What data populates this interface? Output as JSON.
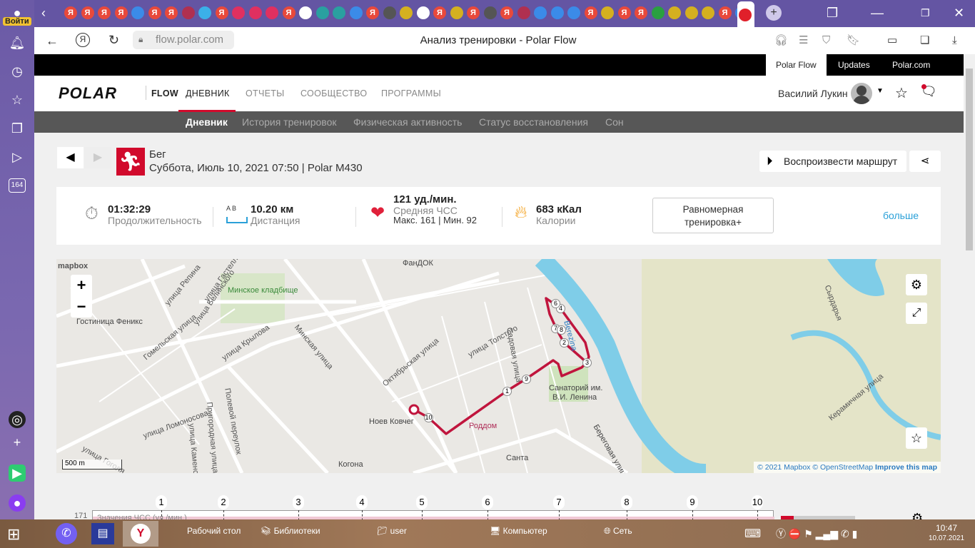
{
  "browser": {
    "login_label": "Войти",
    "sidebar_badge": "164",
    "url": "flow.polar.com",
    "title": "Анализ тренировки - Polar Flow",
    "tab_glyph": "Я"
  },
  "site_tabs": [
    "Polar Flow",
    "Updates",
    "Polar.com"
  ],
  "header": {
    "logo": "POLAR",
    "flow": "FLOW",
    "nav": [
      "ДНЕВНИК",
      "ОТЧЕТЫ",
      "СООБЩЕСТВО",
      "ПРОГРАММЫ"
    ],
    "user": "Василий Лукин"
  },
  "subnav": [
    "Дневник",
    "История тренировок",
    "Физическая активность",
    "Статус восстановления",
    "Сон"
  ],
  "workout": {
    "sport": "Бег",
    "datetime": "Суббота, Июль 10, 2021 07:50 | Polar M430",
    "replay": "Воспроизвести маршрут"
  },
  "stats": {
    "duration": "01:32:29",
    "duration_label": "Продолжительность",
    "distance": "10.20 км",
    "distance_label": "Дистанция",
    "ab": "A  B",
    "hr": "121 уд./мин.",
    "hr_label": "Средняя ЧСС",
    "hr_minmax": "Макс. 161  |  Мин. 92",
    "calories": "683 кКал",
    "calories_label": "Калории",
    "benefit": "Равномерная тренировка+",
    "more": "больше"
  },
  "map": {
    "brand": "mapbox",
    "scale": "500 m",
    "attribution": "© 2021 Mapbox © OpenStreetMap",
    "improve": "Improve this map",
    "labels": [
      "Минское кладбище",
      "Гостиница Феникс",
      "улица Репина",
      "улица Гастелло",
      "улица Белинского",
      "Гомельская улица",
      "улица Крылова",
      "Минская улица",
      "Октябрьская улица",
      "улица Толстого",
      "Садовая улица",
      "Санаторий им.",
      "В.И. Ленина",
      "Роддом",
      "Ноев Ковчег",
      "Когона",
      "Санта",
      "Береговая улица",
      "Berezina",
      "Керамичная улица",
      "ФанДОК",
      "улица Ломоносова",
      "улица Гоголя",
      "Полевой переулок",
      "Пригородная улица",
      "улица Каменского",
      "Сырдарья"
    ],
    "km_markers": [
      "1",
      "2",
      "3",
      "4",
      "6",
      "7",
      "8",
      "9",
      "10"
    ]
  },
  "chart": {
    "ymax_label": "171",
    "legend": "Значения ЧСС (уд./мин.)",
    "km_ticks": [
      "1",
      "2",
      "3",
      "4",
      "5",
      "6",
      "7",
      "8",
      "9",
      "10"
    ]
  },
  "taskbar": {
    "items": [
      "Рабочий стол",
      "Библиотеки",
      "user",
      "Компьютер",
      "Сеть"
    ],
    "time": "10:47",
    "date": "10.07.2021"
  }
}
